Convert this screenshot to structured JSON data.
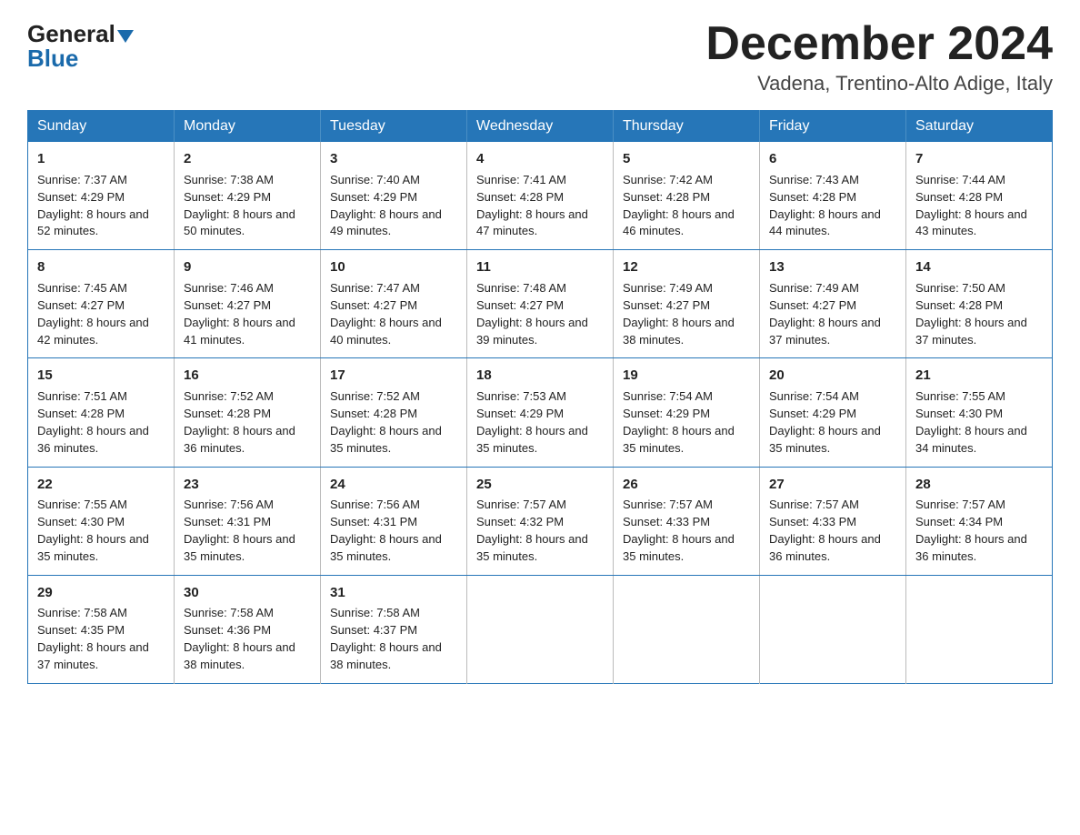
{
  "header": {
    "logo_general": "General",
    "logo_blue": "Blue",
    "month": "December 2024",
    "location": "Vadena, Trentino-Alto Adige, Italy"
  },
  "days_of_week": [
    "Sunday",
    "Monday",
    "Tuesday",
    "Wednesday",
    "Thursday",
    "Friday",
    "Saturday"
  ],
  "weeks": [
    [
      {
        "day": "1",
        "sunrise": "Sunrise: 7:37 AM",
        "sunset": "Sunset: 4:29 PM",
        "daylight": "Daylight: 8 hours and 52 minutes."
      },
      {
        "day": "2",
        "sunrise": "Sunrise: 7:38 AM",
        "sunset": "Sunset: 4:29 PM",
        "daylight": "Daylight: 8 hours and 50 minutes."
      },
      {
        "day": "3",
        "sunrise": "Sunrise: 7:40 AM",
        "sunset": "Sunset: 4:29 PM",
        "daylight": "Daylight: 8 hours and 49 minutes."
      },
      {
        "day": "4",
        "sunrise": "Sunrise: 7:41 AM",
        "sunset": "Sunset: 4:28 PM",
        "daylight": "Daylight: 8 hours and 47 minutes."
      },
      {
        "day": "5",
        "sunrise": "Sunrise: 7:42 AM",
        "sunset": "Sunset: 4:28 PM",
        "daylight": "Daylight: 8 hours and 46 minutes."
      },
      {
        "day": "6",
        "sunrise": "Sunrise: 7:43 AM",
        "sunset": "Sunset: 4:28 PM",
        "daylight": "Daylight: 8 hours and 44 minutes."
      },
      {
        "day": "7",
        "sunrise": "Sunrise: 7:44 AM",
        "sunset": "Sunset: 4:28 PM",
        "daylight": "Daylight: 8 hours and 43 minutes."
      }
    ],
    [
      {
        "day": "8",
        "sunrise": "Sunrise: 7:45 AM",
        "sunset": "Sunset: 4:27 PM",
        "daylight": "Daylight: 8 hours and 42 minutes."
      },
      {
        "day": "9",
        "sunrise": "Sunrise: 7:46 AM",
        "sunset": "Sunset: 4:27 PM",
        "daylight": "Daylight: 8 hours and 41 minutes."
      },
      {
        "day": "10",
        "sunrise": "Sunrise: 7:47 AM",
        "sunset": "Sunset: 4:27 PM",
        "daylight": "Daylight: 8 hours and 40 minutes."
      },
      {
        "day": "11",
        "sunrise": "Sunrise: 7:48 AM",
        "sunset": "Sunset: 4:27 PM",
        "daylight": "Daylight: 8 hours and 39 minutes."
      },
      {
        "day": "12",
        "sunrise": "Sunrise: 7:49 AM",
        "sunset": "Sunset: 4:27 PM",
        "daylight": "Daylight: 8 hours and 38 minutes."
      },
      {
        "day": "13",
        "sunrise": "Sunrise: 7:49 AM",
        "sunset": "Sunset: 4:27 PM",
        "daylight": "Daylight: 8 hours and 37 minutes."
      },
      {
        "day": "14",
        "sunrise": "Sunrise: 7:50 AM",
        "sunset": "Sunset: 4:28 PM",
        "daylight": "Daylight: 8 hours and 37 minutes."
      }
    ],
    [
      {
        "day": "15",
        "sunrise": "Sunrise: 7:51 AM",
        "sunset": "Sunset: 4:28 PM",
        "daylight": "Daylight: 8 hours and 36 minutes."
      },
      {
        "day": "16",
        "sunrise": "Sunrise: 7:52 AM",
        "sunset": "Sunset: 4:28 PM",
        "daylight": "Daylight: 8 hours and 36 minutes."
      },
      {
        "day": "17",
        "sunrise": "Sunrise: 7:52 AM",
        "sunset": "Sunset: 4:28 PM",
        "daylight": "Daylight: 8 hours and 35 minutes."
      },
      {
        "day": "18",
        "sunrise": "Sunrise: 7:53 AM",
        "sunset": "Sunset: 4:29 PM",
        "daylight": "Daylight: 8 hours and 35 minutes."
      },
      {
        "day": "19",
        "sunrise": "Sunrise: 7:54 AM",
        "sunset": "Sunset: 4:29 PM",
        "daylight": "Daylight: 8 hours and 35 minutes."
      },
      {
        "day": "20",
        "sunrise": "Sunrise: 7:54 AM",
        "sunset": "Sunset: 4:29 PM",
        "daylight": "Daylight: 8 hours and 35 minutes."
      },
      {
        "day": "21",
        "sunrise": "Sunrise: 7:55 AM",
        "sunset": "Sunset: 4:30 PM",
        "daylight": "Daylight: 8 hours and 34 minutes."
      }
    ],
    [
      {
        "day": "22",
        "sunrise": "Sunrise: 7:55 AM",
        "sunset": "Sunset: 4:30 PM",
        "daylight": "Daylight: 8 hours and 35 minutes."
      },
      {
        "day": "23",
        "sunrise": "Sunrise: 7:56 AM",
        "sunset": "Sunset: 4:31 PM",
        "daylight": "Daylight: 8 hours and 35 minutes."
      },
      {
        "day": "24",
        "sunrise": "Sunrise: 7:56 AM",
        "sunset": "Sunset: 4:31 PM",
        "daylight": "Daylight: 8 hours and 35 minutes."
      },
      {
        "day": "25",
        "sunrise": "Sunrise: 7:57 AM",
        "sunset": "Sunset: 4:32 PM",
        "daylight": "Daylight: 8 hours and 35 minutes."
      },
      {
        "day": "26",
        "sunrise": "Sunrise: 7:57 AM",
        "sunset": "Sunset: 4:33 PM",
        "daylight": "Daylight: 8 hours and 35 minutes."
      },
      {
        "day": "27",
        "sunrise": "Sunrise: 7:57 AM",
        "sunset": "Sunset: 4:33 PM",
        "daylight": "Daylight: 8 hours and 36 minutes."
      },
      {
        "day": "28",
        "sunrise": "Sunrise: 7:57 AM",
        "sunset": "Sunset: 4:34 PM",
        "daylight": "Daylight: 8 hours and 36 minutes."
      }
    ],
    [
      {
        "day": "29",
        "sunrise": "Sunrise: 7:58 AM",
        "sunset": "Sunset: 4:35 PM",
        "daylight": "Daylight: 8 hours and 37 minutes."
      },
      {
        "day": "30",
        "sunrise": "Sunrise: 7:58 AM",
        "sunset": "Sunset: 4:36 PM",
        "daylight": "Daylight: 8 hours and 38 minutes."
      },
      {
        "day": "31",
        "sunrise": "Sunrise: 7:58 AM",
        "sunset": "Sunset: 4:37 PM",
        "daylight": "Daylight: 8 hours and 38 minutes."
      },
      null,
      null,
      null,
      null
    ]
  ]
}
